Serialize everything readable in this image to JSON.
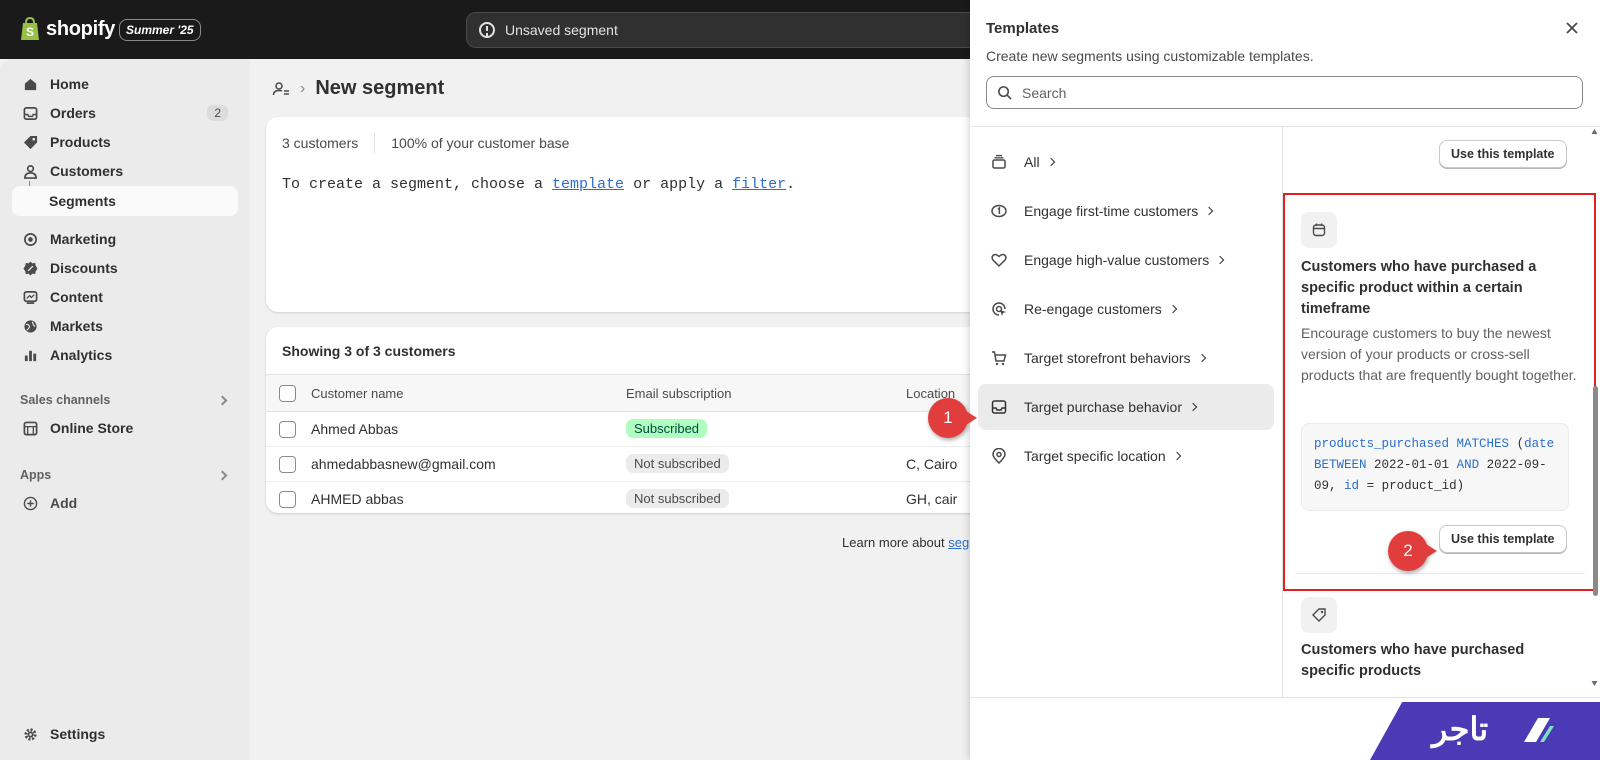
{
  "topbar": {
    "logo_text": "shopify",
    "edition": "Summer '25",
    "status": "Unsaved segment"
  },
  "sidebar": {
    "items": [
      {
        "label": "Home",
        "icon": "home-icon"
      },
      {
        "label": "Orders",
        "icon": "inbox-icon",
        "badge": "2"
      },
      {
        "label": "Products",
        "icon": "tag-icon"
      },
      {
        "label": "Customers",
        "icon": "person-icon"
      },
      {
        "label": "Segments"
      },
      {
        "label": "Marketing",
        "icon": "target-icon"
      },
      {
        "label": "Discounts",
        "icon": "discount-icon"
      },
      {
        "label": "Content",
        "icon": "content-icon"
      },
      {
        "label": "Markets",
        "icon": "globe-icon"
      },
      {
        "label": "Analytics",
        "icon": "chart-bar-icon"
      }
    ],
    "sales_channels": {
      "label": "Sales channels",
      "items": [
        {
          "label": "Online Store",
          "icon": "store-icon"
        }
      ]
    },
    "apps": {
      "label": "Apps",
      "add_label": "Add"
    },
    "settings": "Settings"
  },
  "main": {
    "page_title": "New segment",
    "stats": {
      "count": "3 customers",
      "percent": "100% of your customer base"
    },
    "hint": {
      "prefix": "To create a segment, choose a ",
      "template_link": "template",
      "middle": " or apply a ",
      "filter_link": "filter",
      "suffix": "."
    },
    "table": {
      "showing": "Showing 3 of 3 customers",
      "columns": [
        "Customer name",
        "Email subscription",
        "Location"
      ],
      "rows": [
        {
          "name": "Ahmed Abbas",
          "subscription": "Subscribed",
          "location": ""
        },
        {
          "name": "ahmedabbasnew@gmail.com",
          "subscription": "Not subscribed",
          "location": "C, Cairo"
        },
        {
          "name": "AHMED abbas",
          "subscription": "Not subscribed",
          "location": "GH, cair"
        }
      ]
    },
    "learn_more": {
      "text": "Learn more about ",
      "link": "seg"
    }
  },
  "drawer": {
    "title": "Templates",
    "subtitle": "Create new segments using customizable templates.",
    "search_placeholder": "Search",
    "categories": [
      {
        "label": "All",
        "icon": "stack-icon"
      },
      {
        "label": "Engage first-time customers",
        "icon": "first-time-icon"
      },
      {
        "label": "Engage high-value customers",
        "icon": "heart-icon"
      },
      {
        "label": "Re-engage customers",
        "icon": "cursor-target-icon"
      },
      {
        "label": "Target storefront behaviors",
        "icon": "cart-icon"
      },
      {
        "label": "Target purchase behavior",
        "icon": "inbox-icon",
        "selected": true
      },
      {
        "label": "Target specific location",
        "icon": "location-pin-icon"
      }
    ],
    "use_template_label": "Use this template",
    "featured_template": {
      "title": "Customers who have purchased a specific product within a certain timeframe",
      "description": "Encourage customers to buy the newest version of your products or cross-sell products that are frequently bought together.",
      "code_parts": {
        "field": "products_purchased",
        "op": "MATCHES",
        "open": "(",
        "date": "date",
        "between": "BETWEEN",
        "d1": "2022-01-01",
        "and": "AND",
        "d2a": "2022-09-",
        "d2b": "09",
        "comma": ",",
        "id": "id",
        "eq": "=",
        "pid": "product_id",
        "close": ")"
      }
    },
    "next_template": {
      "title": "Customers who have purchased specific products"
    }
  },
  "annotations": {
    "marker1": "1",
    "marker2": "2",
    "accent": "#e23d3d"
  },
  "brand": {
    "text": "تاجر",
    "color": "#4a3ab5"
  }
}
